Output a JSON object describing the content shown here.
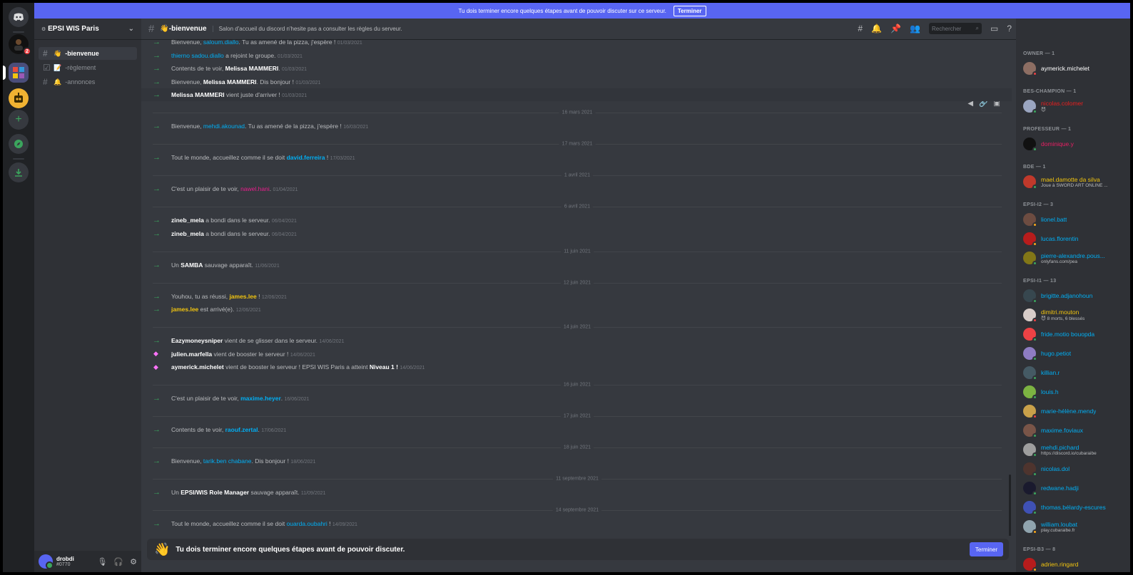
{
  "notice": {
    "text": "Tu dois terminer encore quelques étapes avant de pouvoir discuter sur ce serveur.",
    "button": "Terminer"
  },
  "server": {
    "name": "EPSI WIS Paris",
    "badge_count": "2"
  },
  "channels": [
    {
      "name": "-bienvenue",
      "emoji": "👋",
      "active": true
    },
    {
      "name": "-règlement",
      "emoji": "📝",
      "active": false
    },
    {
      "name": "-annonces",
      "emoji": "🔔",
      "active": false
    }
  ],
  "user": {
    "name": "drobdi",
    "tag": "#0770"
  },
  "header": {
    "channel": "👋-bienvenue",
    "topic": "Salon d'accueil du discord n'hesite pas a consulter les règles du serveur.",
    "search_placeholder": "Rechercher"
  },
  "messages": [
    {
      "kind": "join",
      "parts": [
        [
          "",
          "Bienvenue, "
        ],
        [
          "b",
          "saloum.diallo"
        ],
        [
          "",
          ". Tu as amené de la pizza, j'espère !"
        ]
      ],
      "ts": "01/03/2021"
    },
    {
      "kind": "join",
      "parts": [
        [
          "b",
          "thierno sadou.diallo"
        ],
        [
          "",
          " a rejoint le groupe."
        ]
      ],
      "ts": "01/03/2021"
    },
    {
      "kind": "join",
      "parts": [
        [
          "",
          "Contents de te voir, "
        ],
        [
          "w",
          "Melissa MAMMERI"
        ],
        [
          "",
          "."
        ]
      ],
      "ts": "01/03/2021"
    },
    {
      "kind": "join",
      "parts": [
        [
          "",
          "Bienvenue, "
        ],
        [
          "w",
          "Melissa MAMMERI"
        ],
        [
          "",
          ". Dis bonjour !"
        ]
      ],
      "ts": "01/03/2021"
    },
    {
      "kind": "join",
      "parts": [
        [
          "w",
          "Melissa MAMMERI"
        ],
        [
          "",
          " vient juste d'arriver !"
        ]
      ],
      "ts": "01/03/2021"
    },
    {
      "kind": "divider",
      "label": "16 mars 2021"
    },
    {
      "kind": "join",
      "parts": [
        [
          "",
          "Bienvenue, "
        ],
        [
          "b",
          "mehdi.akounad"
        ],
        [
          "",
          ". Tu as amené de la pizza, j'espère !"
        ]
      ],
      "ts": "16/03/2021"
    },
    {
      "kind": "divider",
      "label": "17 mars 2021"
    },
    {
      "kind": "join",
      "parts": [
        [
          "",
          "Tout le monde, accueillez comme il se doit "
        ],
        [
          "bb",
          "david.ferreira"
        ],
        [
          "",
          " !"
        ]
      ],
      "ts": "17/03/2021"
    },
    {
      "kind": "divider",
      "label": "1 avril 2021"
    },
    {
      "kind": "join",
      "parts": [
        [
          "",
          "C'est un plaisir de te voir, "
        ],
        [
          "p",
          "nawel.hani"
        ],
        [
          "",
          "."
        ]
      ],
      "ts": "01/04/2021"
    },
    {
      "kind": "divider",
      "label": "6 avril 2021"
    },
    {
      "kind": "join",
      "parts": [
        [
          "w",
          "zineb_mela"
        ],
        [
          "",
          " a bondi dans le serveur."
        ]
      ],
      "ts": "06/04/2021"
    },
    {
      "kind": "join",
      "parts": [
        [
          "w",
          "zineb_mela"
        ],
        [
          "",
          " a bondi dans le serveur."
        ]
      ],
      "ts": "06/04/2021"
    },
    {
      "kind": "divider",
      "label": "11 juin 2021"
    },
    {
      "kind": "join",
      "parts": [
        [
          "",
          "Un "
        ],
        [
          "w",
          "SAMBA"
        ],
        [
          "",
          " sauvage apparaît."
        ]
      ],
      "ts": "11/06/2021"
    },
    {
      "kind": "divider",
      "label": "12 juin 2021"
    },
    {
      "kind": "join",
      "parts": [
        [
          "",
          "Youhou, tu as réussi, "
        ],
        [
          "y",
          "james.lee"
        ],
        [
          "",
          " !"
        ]
      ],
      "ts": "12/06/2021"
    },
    {
      "kind": "join",
      "parts": [
        [
          "y",
          "james.lee"
        ],
        [
          "",
          " est arrivé(e)."
        ]
      ],
      "ts": "12/06/2021"
    },
    {
      "kind": "divider",
      "label": "14 juin 2021"
    },
    {
      "kind": "join",
      "parts": [
        [
          "w",
          "Eazymoneysniper"
        ],
        [
          "",
          " vient de se glisser dans le serveur."
        ]
      ],
      "ts": "14/06/2021"
    },
    {
      "kind": "boost",
      "parts": [
        [
          "w",
          "julien.marfella"
        ],
        [
          "",
          " vient de booster le serveur !"
        ]
      ],
      "ts": "14/06/2021"
    },
    {
      "kind": "boost",
      "parts": [
        [
          "w",
          "aymerick.michelet"
        ],
        [
          "",
          " vient de booster le serveur ! EPSI WIS Paris a atteint "
        ],
        [
          "w",
          "Niveau 1 !"
        ]
      ],
      "ts": "14/06/2021"
    },
    {
      "kind": "divider",
      "label": "16 juin 2021"
    },
    {
      "kind": "join",
      "parts": [
        [
          "",
          "C'est un plaisir de te voir, "
        ],
        [
          "bb",
          "maxime.heyer"
        ],
        [
          "",
          "."
        ]
      ],
      "ts": "16/06/2021"
    },
    {
      "kind": "divider",
      "label": "17 juin 2021"
    },
    {
      "kind": "join",
      "parts": [
        [
          "",
          "Contents de te voir, "
        ],
        [
          "bb",
          "raouf.zertal"
        ],
        [
          "",
          "."
        ]
      ],
      "ts": "17/06/2021"
    },
    {
      "kind": "divider",
      "label": "18 juin 2021"
    },
    {
      "kind": "join",
      "parts": [
        [
          "",
          "Bienvenue, "
        ],
        [
          "b",
          "tarik.ben chabane"
        ],
        [
          "",
          ". Dis bonjour !"
        ]
      ],
      "ts": "18/06/2021"
    },
    {
      "kind": "divider",
      "label": "11 septembre 2021"
    },
    {
      "kind": "join",
      "parts": [
        [
          "",
          "Un "
        ],
        [
          "w",
          "EPSI/WIS Role Manager"
        ],
        [
          "",
          " sauvage apparaît."
        ]
      ],
      "ts": "11/09/2021"
    },
    {
      "kind": "divider",
      "label": "14 septembre 2021"
    },
    {
      "kind": "join",
      "parts": [
        [
          "",
          "Tout le monde, accueillez comme il se doit "
        ],
        [
          "b",
          "ouarda.oubahri"
        ],
        [
          "",
          " !"
        ]
      ],
      "ts": "14/09/2021"
    }
  ],
  "composer": {
    "text": "Tu dois terminer encore quelques étapes avant de pouvoir discuter.",
    "button": "Terminer"
  },
  "members": [
    {
      "role": "OWNER — 1",
      "list": [
        {
          "name": "aymerick.michelet",
          "color": "#ffffff",
          "av": "#8d6e63",
          "status": "dnd"
        }
      ]
    },
    {
      "role": "BES-CHAMPION — 1",
      "list": [
        {
          "name": "nicolas.colomer",
          "color": "#e91e1e",
          "av": "#9aa5c0",
          "status": "online",
          "sub": "😈"
        }
      ]
    },
    {
      "role": "PROFESSEUR — 1",
      "list": [
        {
          "name": "dominique.y",
          "color": "#e91e63",
          "av": "#111111",
          "status": "online"
        }
      ]
    },
    {
      "role": "BDE — 1",
      "list": [
        {
          "name": "mael.damotte da silva",
          "color": "#f1c40f",
          "av": "#c0392b",
          "status": "online",
          "sub": "Joue à SWORD ART ONLINE ..."
        }
      ]
    },
    {
      "role": "EPSI-I2 — 3",
      "list": [
        {
          "name": "lionel.batt",
          "color": "#00aff4",
          "av": "#6d4c41",
          "status": "idle"
        },
        {
          "name": "lucas.florentin",
          "color": "#00aff4",
          "av": "#b71c1c",
          "status": "idle"
        },
        {
          "name": "pierre-alexandre.pous...",
          "color": "#00aff4",
          "av": "#827717",
          "status": "online",
          "sub": "onlyfans.com/pea"
        }
      ]
    },
    {
      "role": "EPSI-I1 — 13",
      "list": [
        {
          "name": "brigitte.adjanohoun",
          "color": "#00aff4",
          "av": "#37474f",
          "status": "online"
        },
        {
          "name": "dimitri.mouton",
          "color": "#f1c40f",
          "av": "#d7ccc8",
          "status": "dnd",
          "sub": "😈 8 morts, 6 blessés"
        },
        {
          "name": "fride.motio bouopda",
          "color": "#00aff4",
          "av": "#ed4245",
          "status": "online"
        },
        {
          "name": "hugo.petiot",
          "color": "#00aff4",
          "av": "#8e7cc3",
          "status": "online"
        },
        {
          "name": "killian.r",
          "color": "#00aff4",
          "av": "#455a64",
          "status": "online"
        },
        {
          "name": "louis.h",
          "color": "#00aff4",
          "av": "#7cb342",
          "status": "online"
        },
        {
          "name": "marie-hélène.mendy",
          "color": "#00aff4",
          "av": "#c9a14a",
          "status": "dnd"
        },
        {
          "name": "maxime.foviaux",
          "color": "#00aff4",
          "av": "#795548",
          "status": "online"
        },
        {
          "name": "mehdi.pichard",
          "color": "#00aff4",
          "av": "#9e9e9e",
          "status": "online",
          "sub": "https://discord.io/cubaraibe"
        },
        {
          "name": "nicolas.dol",
          "color": "#00aff4",
          "av": "#4e342e",
          "status": "online"
        },
        {
          "name": "redwane.hadji",
          "color": "#00aff4",
          "av": "#1a1a2e",
          "status": "online"
        },
        {
          "name": "thomas.bélardy-escures",
          "color": "#00aff4",
          "av": "#3f51b5",
          "status": "online"
        },
        {
          "name": "william.loubat",
          "color": "#00aff4",
          "av": "#90a4ae",
          "status": "idle",
          "sub": "play.cubaraibe.fr"
        }
      ]
    },
    {
      "role": "EPSI-B3 — 8",
      "list": [
        {
          "name": "adrien.ringard",
          "color": "#f1c40f",
          "av": "#b71c1c",
          "status": "idle"
        }
      ]
    }
  ]
}
